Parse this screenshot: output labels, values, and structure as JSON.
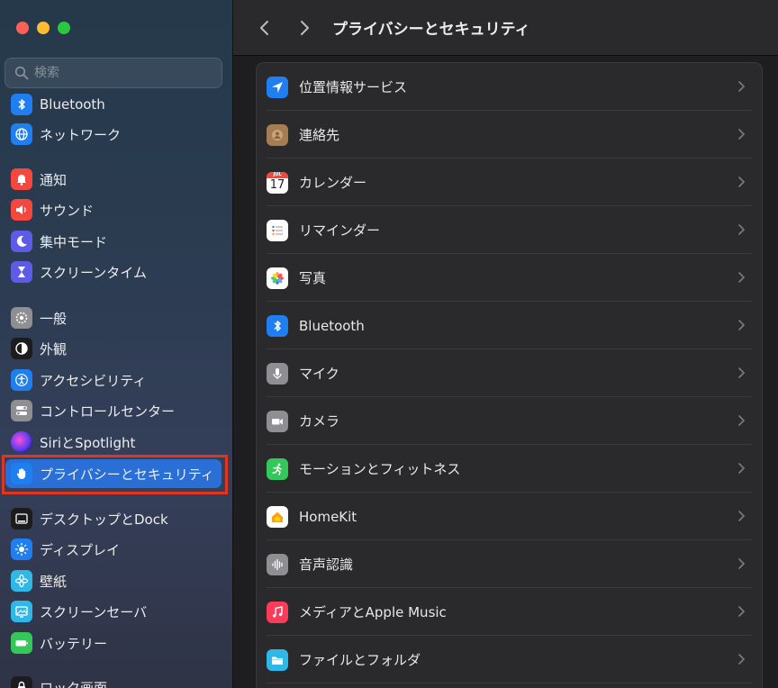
{
  "search": {
    "placeholder": "検索"
  },
  "sidebar": {
    "items": [
      {
        "label": "Bluetooth",
        "icon": "bluetooth-icon",
        "color": "#1f7ff0"
      },
      {
        "label": "ネットワーク",
        "icon": "globe-icon",
        "color": "#1f7ff0"
      },
      {
        "label": "通知",
        "icon": "bell-icon",
        "color": "#f5473e"
      },
      {
        "label": "サウンド",
        "icon": "speaker-icon",
        "color": "#f5473e"
      },
      {
        "label": "集中モード",
        "icon": "moon-icon",
        "color": "#5e5ce6"
      },
      {
        "label": "スクリーンタイム",
        "icon": "hourglass-icon",
        "color": "#5e5ce6"
      },
      {
        "label": "一般",
        "icon": "gear-icon",
        "color": "#8e8e93"
      },
      {
        "label": "外観",
        "icon": "appearance-icon",
        "color": "#1c1c1e"
      },
      {
        "label": "アクセシビリティ",
        "icon": "accessibility-icon",
        "color": "#1f7ff0"
      },
      {
        "label": "コントロールセンター",
        "icon": "toggles-icon",
        "color": "#8e8e93"
      },
      {
        "label": "SiriとSpotlight",
        "icon": "siri-icon",
        "color": "#6b3fd9"
      },
      {
        "label": "プライバシーとセキュリティ",
        "icon": "hand-icon",
        "color": "#1f7ff0"
      },
      {
        "label": "デスクトップとDock",
        "icon": "dock-icon",
        "color": "#1c1c1e"
      },
      {
        "label": "ディスプレイ",
        "icon": "sun-icon",
        "color": "#1f7ff0"
      },
      {
        "label": "壁紙",
        "icon": "flower-icon",
        "color": "#2fb7e8"
      },
      {
        "label": "スクリーンセーバ",
        "icon": "screensaver-icon",
        "color": "#2fb7e8"
      },
      {
        "label": "バッテリー",
        "icon": "battery-icon",
        "color": "#34c759"
      },
      {
        "label": "ロック画面",
        "icon": "lock-icon",
        "color": "#1c1c1e"
      }
    ]
  },
  "toolbar": {
    "title": "プライバシーとセキュリティ"
  },
  "privacy": {
    "items": [
      {
        "label": "位置情報サービス",
        "icon": "location-arrow-icon",
        "color": "#1f7ff0"
      },
      {
        "label": "連絡先",
        "icon": "contacts-icon",
        "color": "#a67c52"
      },
      {
        "label": "カレンダー",
        "icon": "calendar-icon",
        "color": "#ffffff",
        "month": "JUL",
        "day": "17"
      },
      {
        "label": "リマインダー",
        "icon": "reminders-icon",
        "color": "#ffffff"
      },
      {
        "label": "写真",
        "icon": "photos-icon",
        "color": "#ffffff"
      },
      {
        "label": "Bluetooth",
        "icon": "bluetooth-icon",
        "color": "#1f7ff0"
      },
      {
        "label": "マイク",
        "icon": "microphone-icon",
        "color": "#8e8e93"
      },
      {
        "label": "カメラ",
        "icon": "camera-icon",
        "color": "#8e8e93"
      },
      {
        "label": "モーションとフィットネス",
        "icon": "running-icon",
        "color": "#34c759"
      },
      {
        "label": "HomeKit",
        "icon": "home-icon",
        "color": "#ffffff"
      },
      {
        "label": "音声認識",
        "icon": "waveform-icon",
        "color": "#8e8e93"
      },
      {
        "label": "メディアとApple Music",
        "icon": "music-icon",
        "color": "#fa3c5a"
      },
      {
        "label": "ファイルとフォルダ",
        "icon": "folder-icon",
        "color": "#2fb7e8"
      }
    ]
  }
}
